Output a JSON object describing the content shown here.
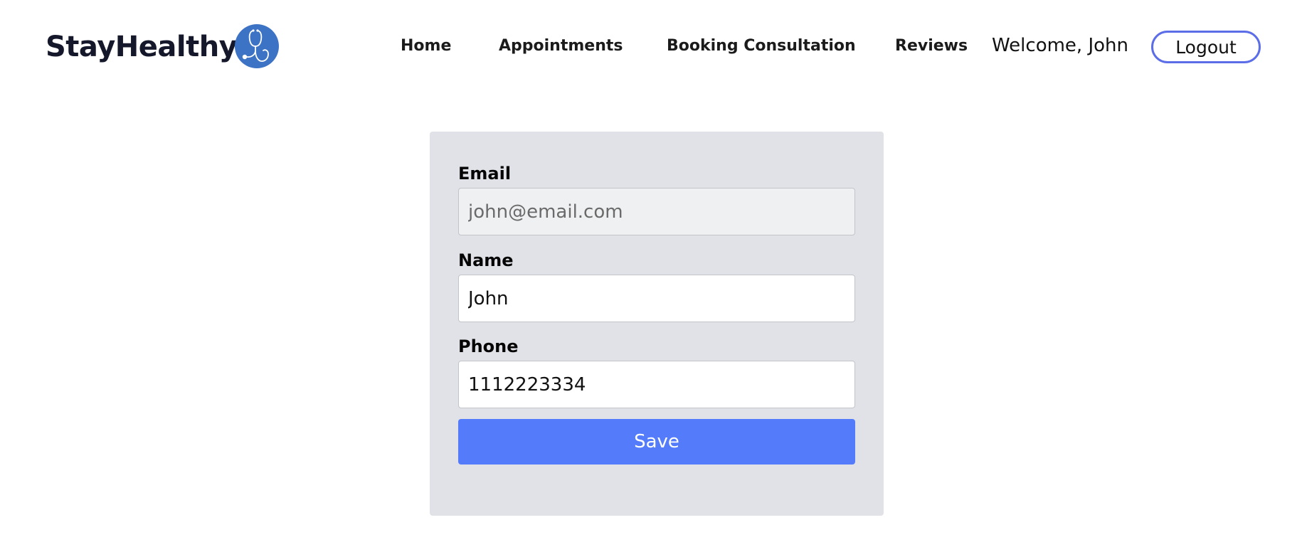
{
  "header": {
    "brand_name": "StayHealthy",
    "brand_icon": "stethoscope-icon",
    "nav_items": [
      {
        "label": "Home"
      },
      {
        "label": "Appointments"
      },
      {
        "label": "Booking Consultation"
      },
      {
        "label": "Reviews"
      }
    ],
    "welcome_text": "Welcome, John",
    "logout_label": "Logout"
  },
  "profile_form": {
    "email_label": "Email",
    "email_placeholder": "john@email.com",
    "name_label": "Name",
    "name_value": "John",
    "phone_label": "Phone",
    "phone_value": "1112223334",
    "save_label": "Save"
  },
  "colors": {
    "brand_logo": "#3d73c4",
    "accent_button": "#537bfa",
    "logout_border": "#5b6ee8",
    "card_background": "#e1e2e7"
  }
}
